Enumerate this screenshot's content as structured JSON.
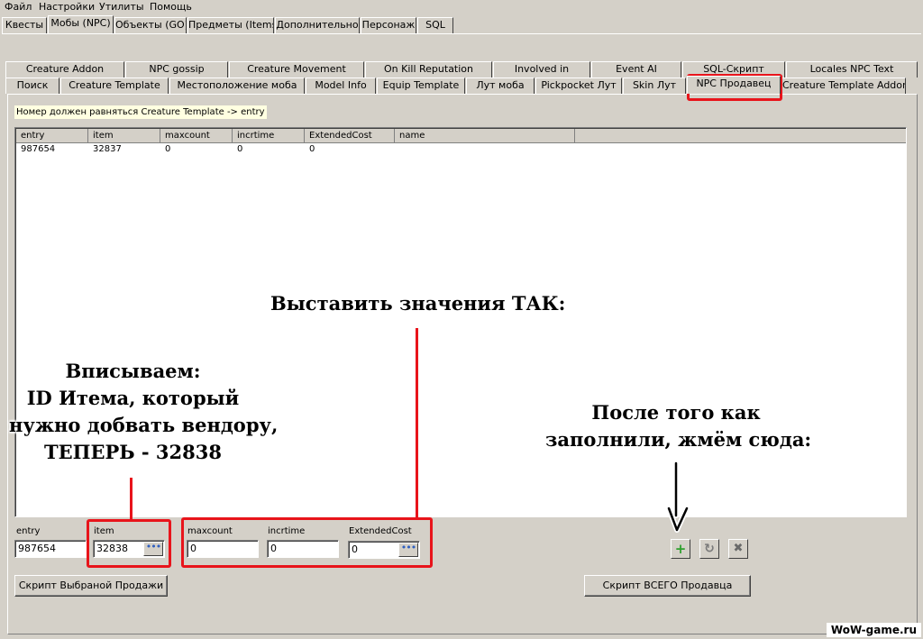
{
  "menu": [
    "Файл",
    "Настройки",
    "Утилиты",
    "Помощь"
  ],
  "main_tabs": [
    "Квесты",
    "Мобы (NPC)",
    "Объекты (GO)",
    "Предметы (Items)",
    "Дополнительно",
    "Персонаж",
    "SQL"
  ],
  "main_tab_active": "Мобы (NPC)",
  "sub_tabs_row1": [
    "Creature Addon",
    "NPC gossip",
    "Creature Movement",
    "On Kill Reputation",
    "Involved in",
    "Event AI",
    "SQL-Скрипт",
    "Locales NPC Text"
  ],
  "sub_tabs_row2": [
    "Поиск",
    "Creature Template",
    "Местоположение моба",
    "Model Info",
    "Equip Template",
    "Лут моба",
    "Pickpocket Лут",
    "Skin Лут",
    "NPC Продавец",
    "Creature Template Addon"
  ],
  "sub_tab_active": "NPC Продавец",
  "hint": "Номер должен равняться Creature Template -> entry",
  "grid": {
    "columns": [
      "entry",
      "item",
      "maxcount",
      "incrtime",
      "ExtendedCost",
      "name"
    ],
    "rows": [
      [
        "987654",
        "32837",
        "0",
        "0",
        "0",
        ""
      ]
    ]
  },
  "fields": {
    "entry": {
      "label": "entry",
      "value": "987654"
    },
    "item": {
      "label": "item",
      "value": "32838"
    },
    "maxcount": {
      "label": "maxcount",
      "value": "0"
    },
    "incrtime": {
      "label": "incrtime",
      "value": "0"
    },
    "extendedcost": {
      "label": "ExtendedCost",
      "value": "0"
    }
  },
  "buttons": {
    "script_selected": "Скрипт Выбраной Продажи",
    "script_all": "Скрипт ВСЕГО Продавца",
    "ellipsis": "•••",
    "add": "+",
    "refresh": "↻",
    "delete": "✖"
  },
  "annotations": {
    "set_values": "Выставить значения ТАК:",
    "enter_item": [
      "Вписываем:",
      "ID Итема, который",
      "нужно добвать вендору,",
      "ТЕПЕРЬ - 32838"
    ],
    "after_fill": [
      "После того как",
      "заполнили, жмём сюда:"
    ]
  },
  "watermark": "WoW-game.ru",
  "colors": {
    "annotation_red": "#e8141b",
    "window_bg": "#d4d0c8",
    "hint_bg": "#ffffe1"
  }
}
